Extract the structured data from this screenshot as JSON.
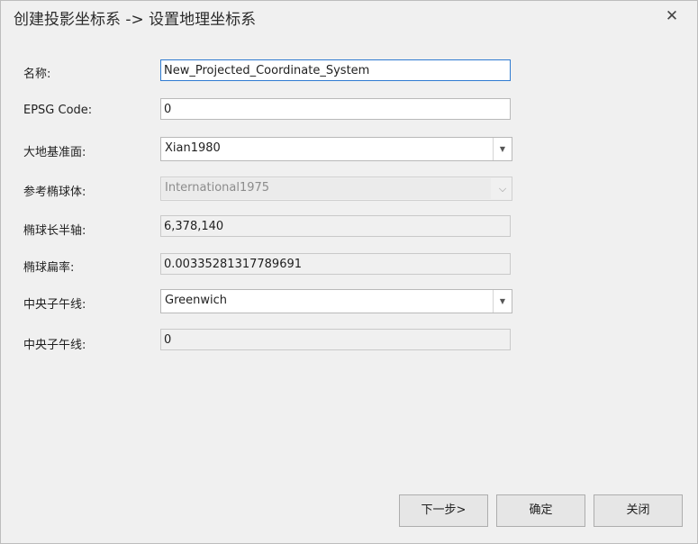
{
  "window": {
    "title": "创建投影坐标系 -> 设置地理坐标系",
    "close_glyph": "✕"
  },
  "form": {
    "name_label": "名称:",
    "name_value": "New_Projected_Coordinate_System",
    "epsg_label": "EPSG Code:",
    "epsg_value": "0",
    "datum_label": "大地基准面:",
    "datum_value": "Xian1980",
    "ellipsoid_label": "参考椭球体:",
    "ellipsoid_value": "International1975",
    "semi_major_label": "椭球长半轴:",
    "semi_major_value": "6,378,140",
    "flattening_label": "椭球扁率:",
    "flattening_value": "0.00335281317789691",
    "meridian_label": "中央子午线:",
    "meridian_value": "Greenwich",
    "meridian_offset_label": "中央子午线:",
    "meridian_offset_value": "0"
  },
  "buttons": {
    "next": "下一步>",
    "ok": "确定",
    "close": "关闭"
  },
  "icons": {
    "dropdown": "▼",
    "dropdown_disabled": "⌵"
  }
}
